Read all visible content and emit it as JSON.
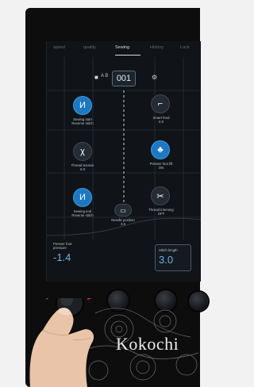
{
  "tabs": {
    "items": [
      {
        "label": "speed"
      },
      {
        "label": "quality"
      },
      {
        "label": "Sewing"
      },
      {
        "label": "History"
      },
      {
        "label": "Lock"
      }
    ]
  },
  "header": {
    "mode_text": "A B",
    "stitch_number": "001",
    "icons": [
      "lock-icon",
      "settings-icon"
    ]
  },
  "controls": {
    "sewing_start": {
      "label_line1": "Sewing start",
      "label_line2": "Reverse stitch",
      "icon": "reverse-stitch-icon",
      "glyph": "И"
    },
    "smart_feed": {
      "label_line1": "Smart feed",
      "label_line2": "0.0",
      "icon": "boot-icon",
      "glyph": "⌐"
    },
    "thread_tension": {
      "label_line1": "Thread tension",
      "label_line2": "0.0",
      "icon": "tension-icon",
      "glyph": "χ"
    },
    "presser_foot_lift": {
      "label_line1": "Presser foot lift",
      "label_line2": "ON",
      "icon": "foot-lift-icon",
      "glyph": "♣"
    },
    "sewing_end": {
      "label_line1": "Sewing end",
      "label_line2": "Reverse stitch",
      "icon": "reverse-stitch-icon",
      "glyph": "И"
    },
    "thread_trimming": {
      "label_line1": "Thread trimming",
      "label_line2": "OFF",
      "icon": "scissors-icon",
      "glyph": "✂"
    },
    "needle_position": {
      "label_line1": "Needle position",
      "label_line2": "3.5",
      "icon": "needle-position-icon",
      "glyph": "▭"
    }
  },
  "presser_foot_pressure": {
    "label_line1": "Presser foot",
    "label_line2": "pressure",
    "value": "-1.4"
  },
  "stitch_length": {
    "label": "Stitch length",
    "value": "3.0"
  },
  "brand": "Kokochi",
  "colors": {
    "accent": "#1d78c1",
    "value_text": "#6fb0e8",
    "screen_bg": "#101418",
    "rotate_arrow": "#e0431e"
  }
}
